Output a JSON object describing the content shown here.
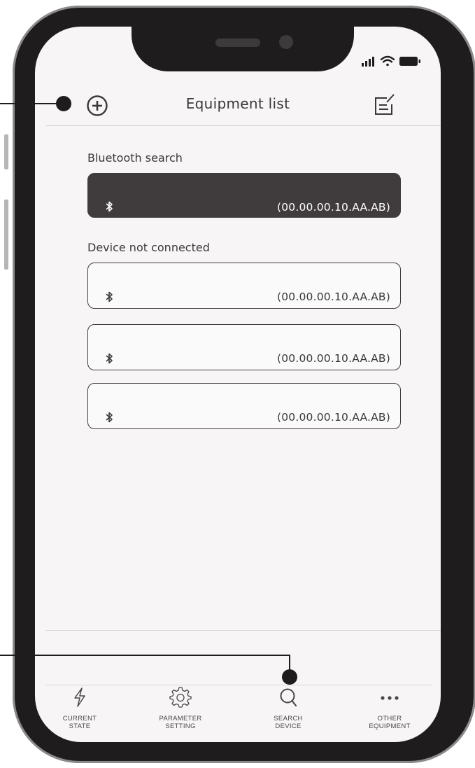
{
  "header": {
    "title": "Equipment list",
    "add_icon": "plus-circle-icon",
    "edit_icon": "edit-note-icon"
  },
  "status_bar": {
    "icons": [
      "signal-icon",
      "wifi-icon",
      "battery-icon"
    ]
  },
  "sections": {
    "bluetooth_search_label": "Bluetooth search",
    "not_connected_label": "Device not connected"
  },
  "bluetooth_search": [
    {
      "mac": "(00.00.00.10.AA.AB)",
      "icon": "bluetooth-icon"
    }
  ],
  "not_connected": [
    {
      "mac": "(00.00.00.10.AA.AB)",
      "icon": "bluetooth-icon"
    },
    {
      "mac": "(00.00.00.10.AA.AB)",
      "icon": "bluetooth-icon"
    },
    {
      "mac": "(00.00.00.10.AA.AB)",
      "icon": "bluetooth-icon"
    }
  ],
  "tabs": [
    {
      "label": "CURRENT\nSTATE",
      "icon": "lightning-icon"
    },
    {
      "label": "PARAMETER\nSETTING",
      "icon": "gear-icon"
    },
    {
      "label": "SEARCH\nDEVICE",
      "icon": "search-icon"
    },
    {
      "label": "OTHER\nEQUIPMENT",
      "icon": "more-dots-icon"
    }
  ],
  "colors": {
    "phone_body": "#1f1c1d",
    "screen_bg": "#f7f5f6",
    "selected_card": "#403c3d",
    "text": "#3b3839"
  }
}
